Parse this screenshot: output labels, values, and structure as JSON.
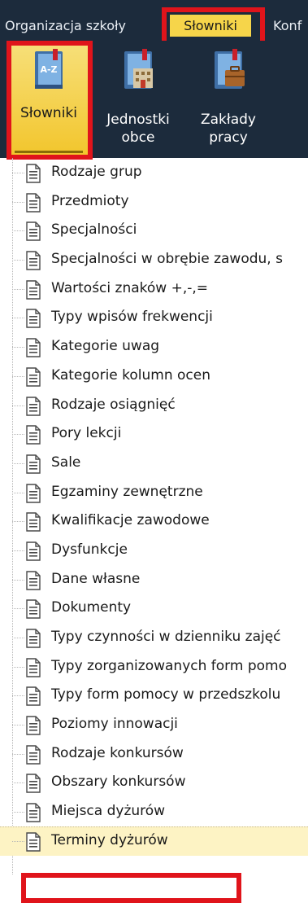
{
  "menu": {
    "items": [
      "Organizacja szkoły",
      "Słowniki",
      "Konf"
    ],
    "active": "Słowniki",
    "accent_color": "#f6d54a",
    "bar_color": "#1c2b3c"
  },
  "ribbon": {
    "buttons": [
      {
        "label": "Słowniki",
        "icon": "dictionary-book-icon",
        "icon_text": "A-Z",
        "active": true
      },
      {
        "label": "Jednostki obce",
        "line1": "Jednostki",
        "line2": "obce",
        "icon": "building-book-icon"
      },
      {
        "label": "Zakłady pracy",
        "line1": "Zakłady",
        "line2": "pracy",
        "icon": "briefcase-book-icon"
      }
    ]
  },
  "tree": {
    "items": [
      "Rodzaje grup",
      "Przedmioty",
      "Specjalności",
      "Specjalności w obrębie zawodu, s",
      "Wartości znaków +,-,=",
      "Typy wpisów frekwencji",
      "Kategorie uwag",
      "Kategorie kolumn ocen",
      "Rodzaje osiągnięć",
      "Pory lekcji",
      "Sale",
      "Egzaminy zewnętrzne",
      "Kwalifikacje zawodowe",
      "Dysfunkcje",
      "Dane własne",
      "Dokumenty",
      "Typy czynności w dzienniku zajęć",
      "Typy zorganizowanych form pomo",
      "Typy form pomocy w przedszkolu",
      "Poziomy innowacji",
      "Rodzaje konkursów",
      "Obszary konkursów",
      "Miejsca dyżurów",
      "Terminy dyżurów"
    ],
    "selected": "Terminy dyżurów",
    "item_icon": "document-icon"
  },
  "highlight_color": "#e0141b"
}
